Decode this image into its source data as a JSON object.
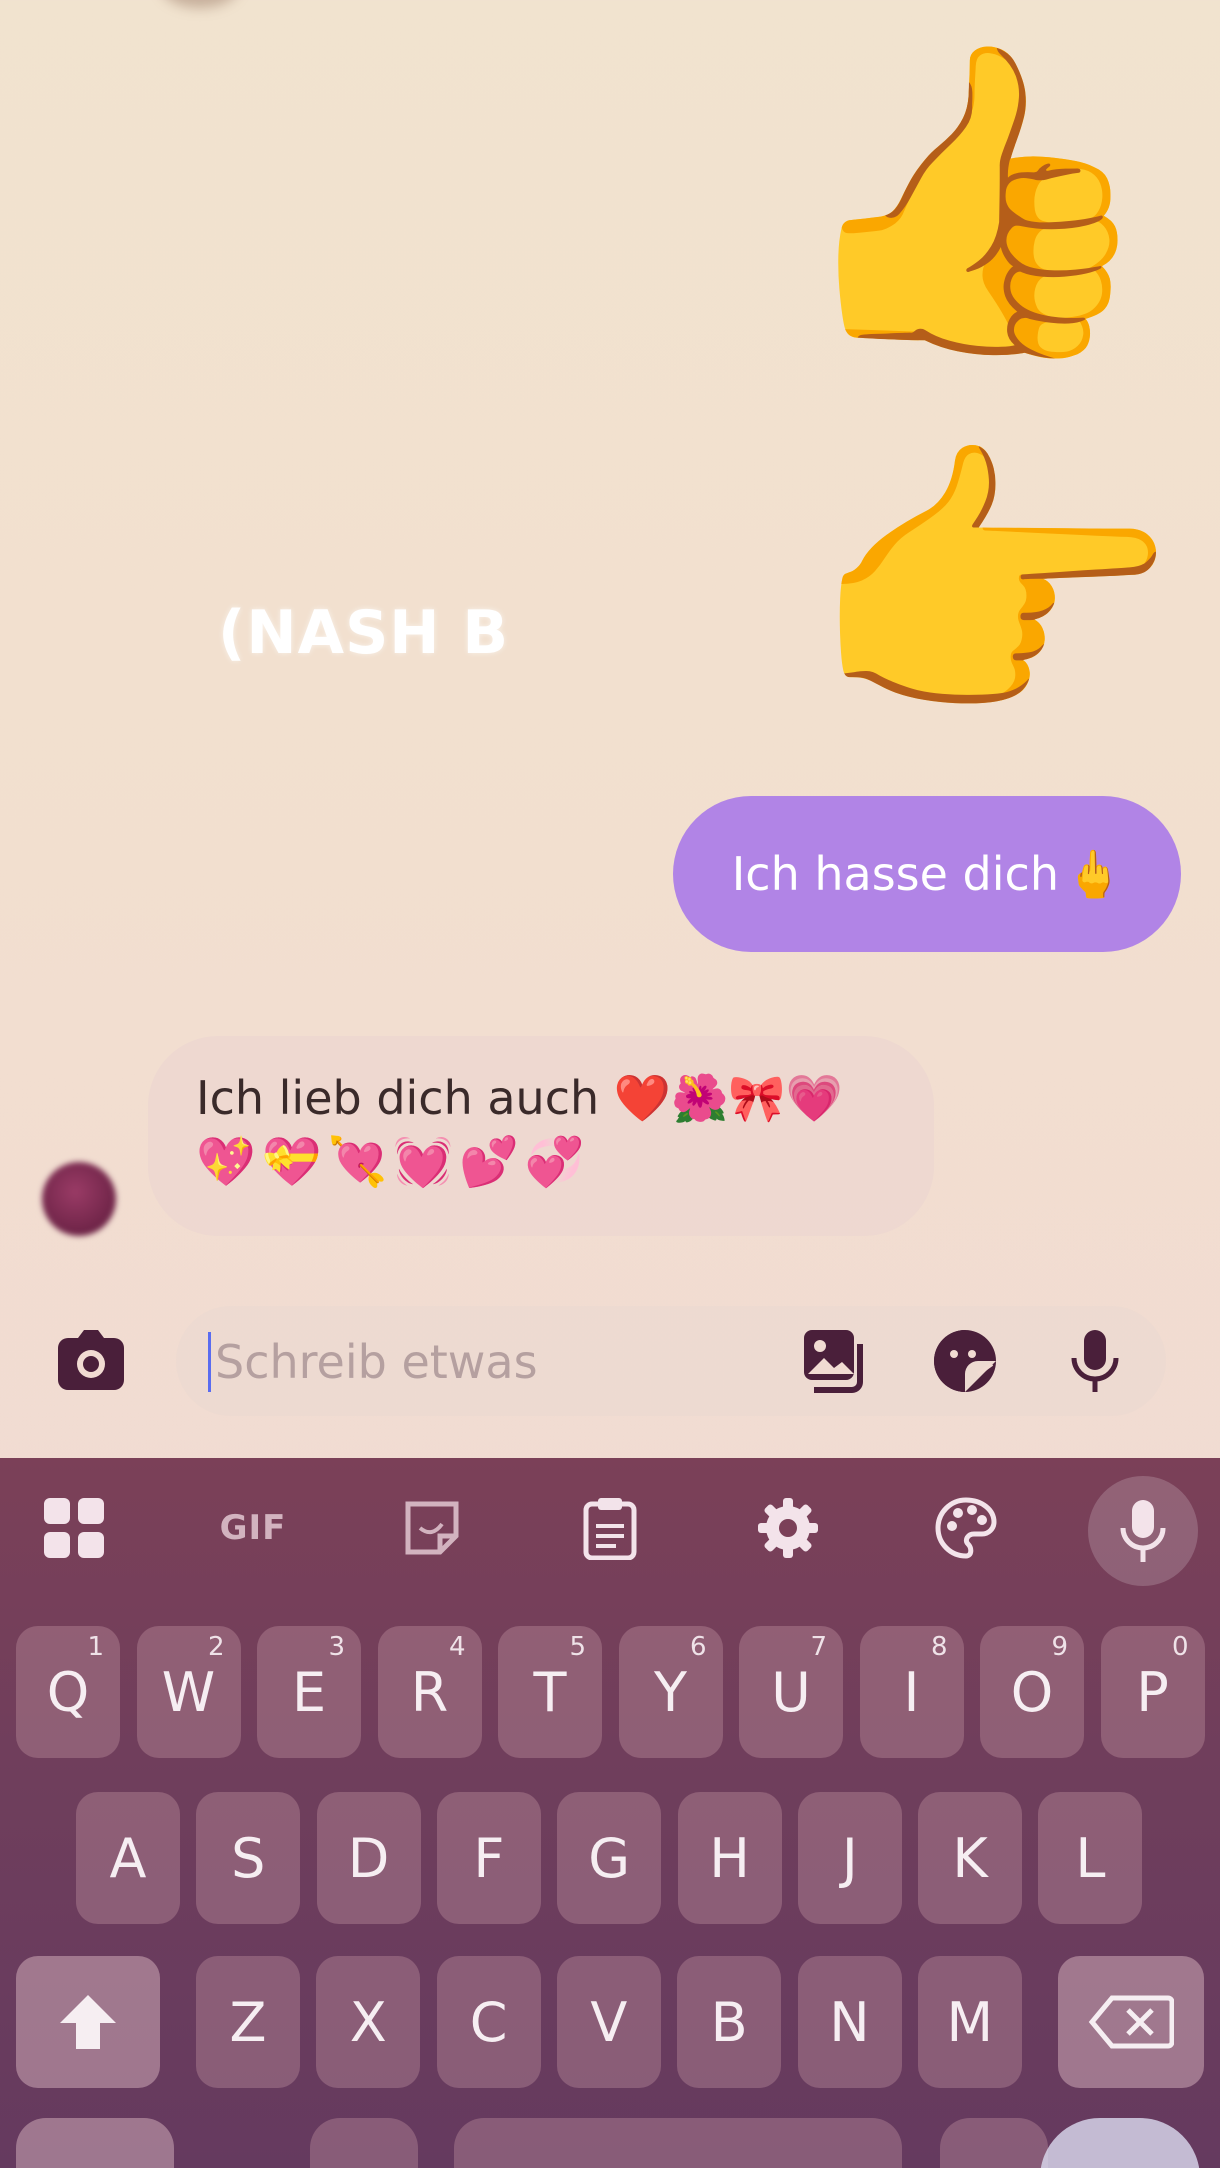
{
  "chat": {
    "overlay_text": "(NASH B",
    "emoji_thumbs": "👍",
    "emoji_pointer": "👉",
    "sent_message": {
      "text": "Ich hasse dich",
      "emoji": "🖕"
    },
    "received_message": {
      "line1": "Ich lieb dich auch ❤️🌺🎀💗",
      "line2": "💖💝💘💓💕💞"
    }
  },
  "composer": {
    "placeholder": "Schreib etwas",
    "value": ""
  },
  "keyboard": {
    "toolbar": {
      "gif_label": "GIF"
    },
    "rows": [
      [
        {
          "label": "Q",
          "hint": "1"
        },
        {
          "label": "W",
          "hint": "2"
        },
        {
          "label": "E",
          "hint": "3"
        },
        {
          "label": "R",
          "hint": "4"
        },
        {
          "label": "T",
          "hint": "5"
        },
        {
          "label": "Y",
          "hint": "6"
        },
        {
          "label": "U",
          "hint": "7"
        },
        {
          "label": "I",
          "hint": "8"
        },
        {
          "label": "O",
          "hint": "9"
        },
        {
          "label": "P",
          "hint": "0"
        }
      ],
      [
        {
          "label": "A"
        },
        {
          "label": "S"
        },
        {
          "label": "D"
        },
        {
          "label": "F"
        },
        {
          "label": "G"
        },
        {
          "label": "H"
        },
        {
          "label": "J"
        },
        {
          "label": "K"
        },
        {
          "label": "L"
        }
      ],
      [
        {
          "label": "Z"
        },
        {
          "label": "X"
        },
        {
          "label": "C"
        },
        {
          "label": "V"
        },
        {
          "label": "B"
        },
        {
          "label": "N"
        },
        {
          "label": "M"
        }
      ]
    ]
  },
  "colors": {
    "sent_bubble": "#b184e6",
    "keyboard_bg": "#6f3e5c",
    "icon_dark": "#4a1f3a"
  }
}
